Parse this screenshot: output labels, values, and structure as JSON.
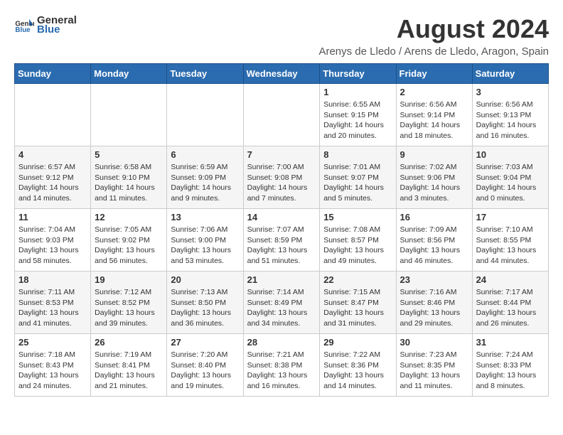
{
  "logo": {
    "general": "General",
    "blue": "Blue"
  },
  "header": {
    "title": "August 2024",
    "subtitle": "Arenys de Lledo / Arens de Lledo, Aragon, Spain"
  },
  "weekdays": [
    "Sunday",
    "Monday",
    "Tuesday",
    "Wednesday",
    "Thursday",
    "Friday",
    "Saturday"
  ],
  "weeks": [
    [
      {
        "day": "",
        "info": ""
      },
      {
        "day": "",
        "info": ""
      },
      {
        "day": "",
        "info": ""
      },
      {
        "day": "",
        "info": ""
      },
      {
        "day": "1",
        "info": "Sunrise: 6:55 AM\nSunset: 9:15 PM\nDaylight: 14 hours\nand 20 minutes."
      },
      {
        "day": "2",
        "info": "Sunrise: 6:56 AM\nSunset: 9:14 PM\nDaylight: 14 hours\nand 18 minutes."
      },
      {
        "day": "3",
        "info": "Sunrise: 6:56 AM\nSunset: 9:13 PM\nDaylight: 14 hours\nand 16 minutes."
      }
    ],
    [
      {
        "day": "4",
        "info": "Sunrise: 6:57 AM\nSunset: 9:12 PM\nDaylight: 14 hours\nand 14 minutes."
      },
      {
        "day": "5",
        "info": "Sunrise: 6:58 AM\nSunset: 9:10 PM\nDaylight: 14 hours\nand 11 minutes."
      },
      {
        "day": "6",
        "info": "Sunrise: 6:59 AM\nSunset: 9:09 PM\nDaylight: 14 hours\nand 9 minutes."
      },
      {
        "day": "7",
        "info": "Sunrise: 7:00 AM\nSunset: 9:08 PM\nDaylight: 14 hours\nand 7 minutes."
      },
      {
        "day": "8",
        "info": "Sunrise: 7:01 AM\nSunset: 9:07 PM\nDaylight: 14 hours\nand 5 minutes."
      },
      {
        "day": "9",
        "info": "Sunrise: 7:02 AM\nSunset: 9:06 PM\nDaylight: 14 hours\nand 3 minutes."
      },
      {
        "day": "10",
        "info": "Sunrise: 7:03 AM\nSunset: 9:04 PM\nDaylight: 14 hours\nand 0 minutes."
      }
    ],
    [
      {
        "day": "11",
        "info": "Sunrise: 7:04 AM\nSunset: 9:03 PM\nDaylight: 13 hours\nand 58 minutes."
      },
      {
        "day": "12",
        "info": "Sunrise: 7:05 AM\nSunset: 9:02 PM\nDaylight: 13 hours\nand 56 minutes."
      },
      {
        "day": "13",
        "info": "Sunrise: 7:06 AM\nSunset: 9:00 PM\nDaylight: 13 hours\nand 53 minutes."
      },
      {
        "day": "14",
        "info": "Sunrise: 7:07 AM\nSunset: 8:59 PM\nDaylight: 13 hours\nand 51 minutes."
      },
      {
        "day": "15",
        "info": "Sunrise: 7:08 AM\nSunset: 8:57 PM\nDaylight: 13 hours\nand 49 minutes."
      },
      {
        "day": "16",
        "info": "Sunrise: 7:09 AM\nSunset: 8:56 PM\nDaylight: 13 hours\nand 46 minutes."
      },
      {
        "day": "17",
        "info": "Sunrise: 7:10 AM\nSunset: 8:55 PM\nDaylight: 13 hours\nand 44 minutes."
      }
    ],
    [
      {
        "day": "18",
        "info": "Sunrise: 7:11 AM\nSunset: 8:53 PM\nDaylight: 13 hours\nand 41 minutes."
      },
      {
        "day": "19",
        "info": "Sunrise: 7:12 AM\nSunset: 8:52 PM\nDaylight: 13 hours\nand 39 minutes."
      },
      {
        "day": "20",
        "info": "Sunrise: 7:13 AM\nSunset: 8:50 PM\nDaylight: 13 hours\nand 36 minutes."
      },
      {
        "day": "21",
        "info": "Sunrise: 7:14 AM\nSunset: 8:49 PM\nDaylight: 13 hours\nand 34 minutes."
      },
      {
        "day": "22",
        "info": "Sunrise: 7:15 AM\nSunset: 8:47 PM\nDaylight: 13 hours\nand 31 minutes."
      },
      {
        "day": "23",
        "info": "Sunrise: 7:16 AM\nSunset: 8:46 PM\nDaylight: 13 hours\nand 29 minutes."
      },
      {
        "day": "24",
        "info": "Sunrise: 7:17 AM\nSunset: 8:44 PM\nDaylight: 13 hours\nand 26 minutes."
      }
    ],
    [
      {
        "day": "25",
        "info": "Sunrise: 7:18 AM\nSunset: 8:43 PM\nDaylight: 13 hours\nand 24 minutes."
      },
      {
        "day": "26",
        "info": "Sunrise: 7:19 AM\nSunset: 8:41 PM\nDaylight: 13 hours\nand 21 minutes."
      },
      {
        "day": "27",
        "info": "Sunrise: 7:20 AM\nSunset: 8:40 PM\nDaylight: 13 hours\nand 19 minutes."
      },
      {
        "day": "28",
        "info": "Sunrise: 7:21 AM\nSunset: 8:38 PM\nDaylight: 13 hours\nand 16 minutes."
      },
      {
        "day": "29",
        "info": "Sunrise: 7:22 AM\nSunset: 8:36 PM\nDaylight: 13 hours\nand 14 minutes."
      },
      {
        "day": "30",
        "info": "Sunrise: 7:23 AM\nSunset: 8:35 PM\nDaylight: 13 hours\nand 11 minutes."
      },
      {
        "day": "31",
        "info": "Sunrise: 7:24 AM\nSunset: 8:33 PM\nDaylight: 13 hours\nand 8 minutes."
      }
    ]
  ]
}
